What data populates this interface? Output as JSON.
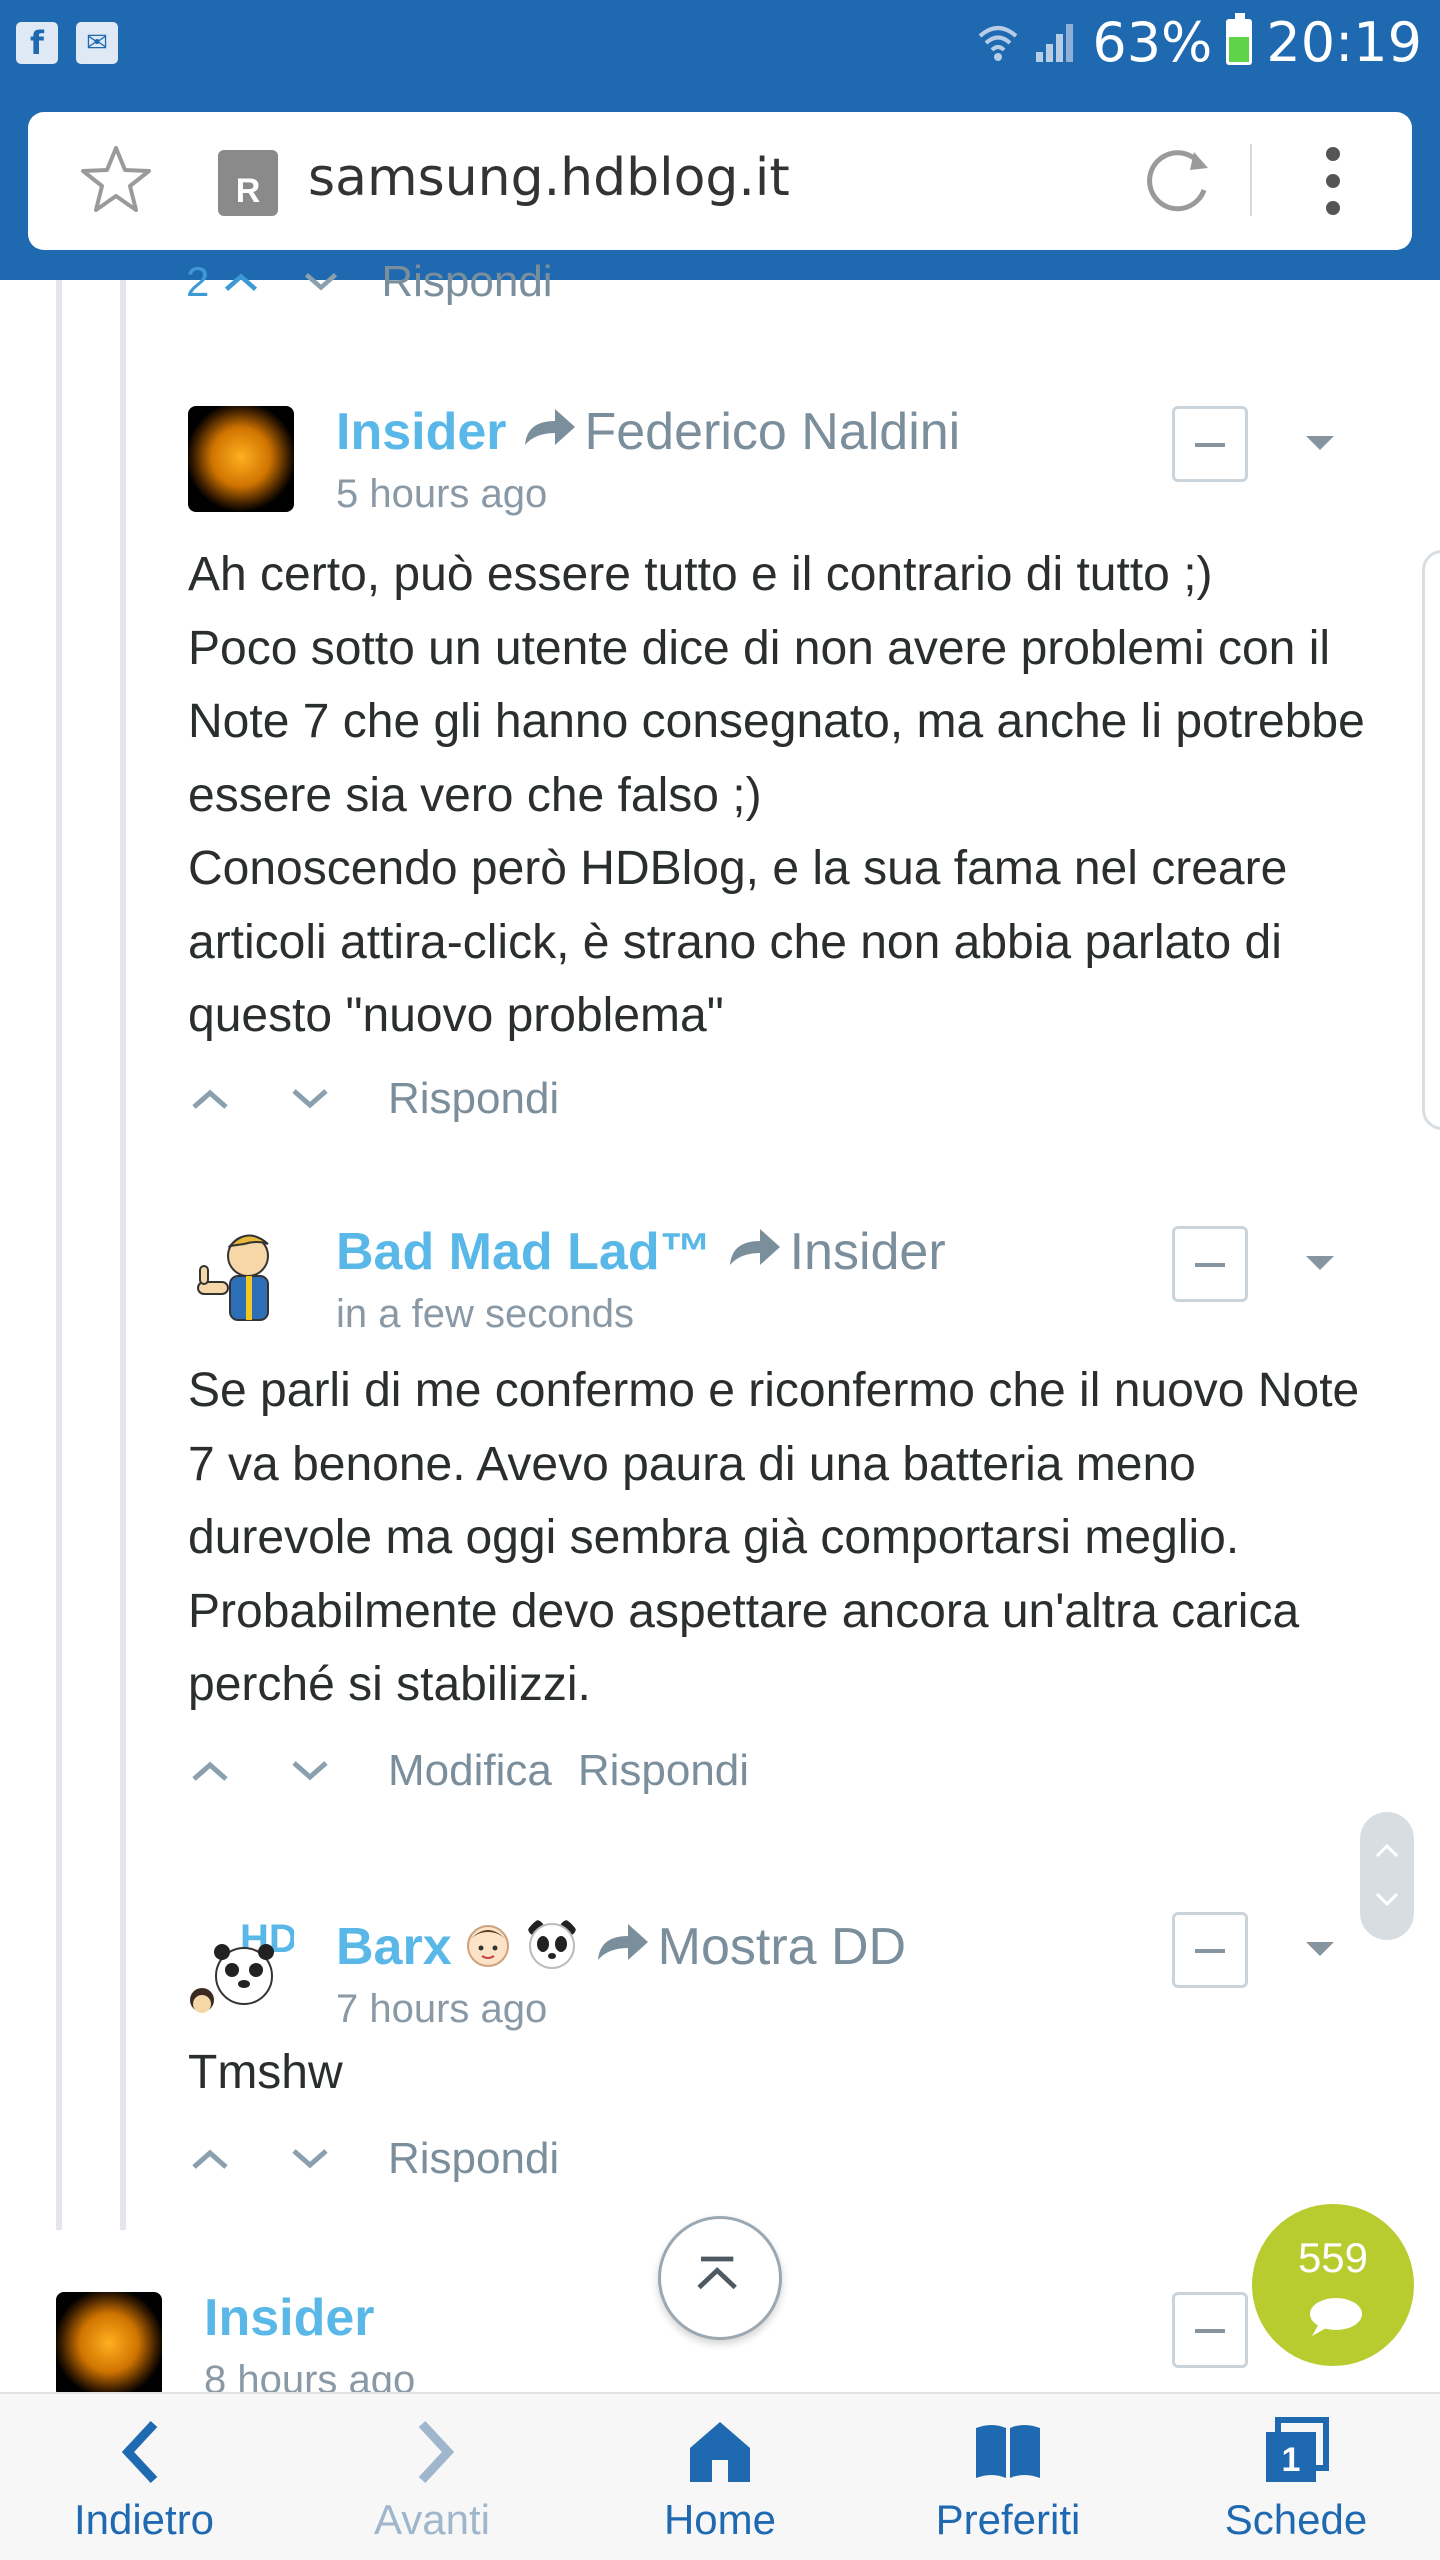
{
  "status_bar": {
    "battery_percent": "63%",
    "battery_level": 0.63,
    "time": "20:19",
    "left_icons": [
      "facebook-icon",
      "mail-icon"
    ]
  },
  "browser": {
    "url": "samsung.hdblog.it"
  },
  "partial_comment": {
    "vote_count": "2",
    "reply_label": "Rispondi"
  },
  "comments": [
    {
      "author": "Insider",
      "reply_to": "Federico Naldini",
      "time": "5 hours ago",
      "text": "Ah certo, può essere tutto e il contrario di tutto ;)\nPoco sotto un utente dice di non avere problemi con il Note 7 che gli hanno consegnato, ma anche li potrebbe essere sia vero che falso ;)\nConoscendo però HDBlog, e la sua fama nel creare articoli attira-click, è strano che non abbia parlato di questo \"nuovo problema\"",
      "reply_label": "Rispondi"
    },
    {
      "author": "Bad Mad Lad™",
      "reply_to": "Insider",
      "time": "in a few seconds",
      "text": "Se parli di me confermo e riconfermo che il nuovo Note 7 va benone. Avevo paura di una batteria meno durevole ma oggi sembra già comportarsi meglio. Probabilmente devo aspettare ancora un'altra carica perché si stabilizzi.",
      "edit_label": "Modifica",
      "reply_label": "Rispondi"
    },
    {
      "author": "Barx",
      "reply_to": "Mostra DD",
      "time": "7 hours ago",
      "text": "Tmshw",
      "reply_label": "Rispondi"
    },
    {
      "author": "Insider",
      "time": "8 hours ago"
    }
  ],
  "comment_count": "559",
  "bottom_nav": [
    {
      "label": "Indietro",
      "icon": "back-icon"
    },
    {
      "label": "Avanti",
      "icon": "forward-icon"
    },
    {
      "label": "Home",
      "icon": "home-icon"
    },
    {
      "label": "Preferiti",
      "icon": "bookmarks-icon"
    },
    {
      "label": "Schede",
      "icon": "tabs-icon",
      "badge": "1"
    }
  ],
  "colors": {
    "browser_blue": "#1f69b1",
    "author_blue": "#5ab8e8",
    "fab_green": "#b8cc2f"
  }
}
